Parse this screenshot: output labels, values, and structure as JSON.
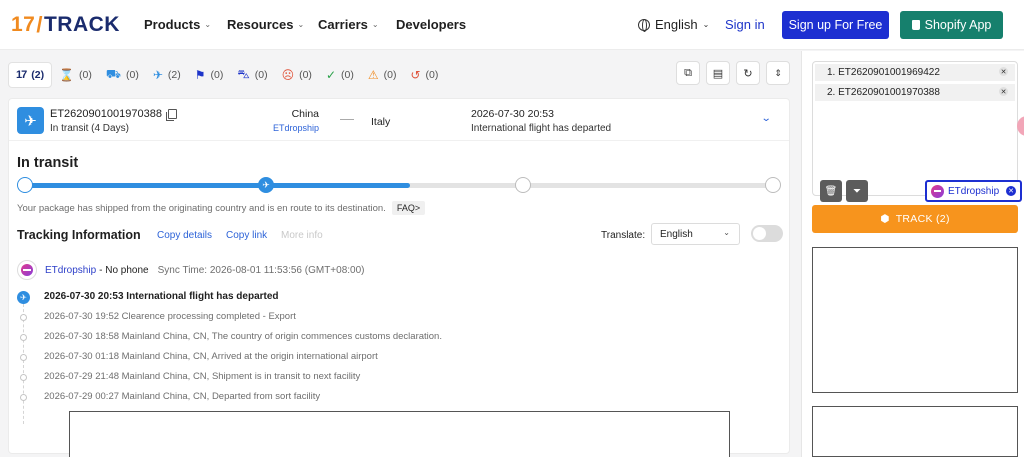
{
  "logo": {
    "num": "17",
    "word": "TRACK"
  },
  "nav": {
    "products": "Products",
    "resources": "Resources",
    "carriers": "Carriers",
    "developers": "Developers",
    "language": "English",
    "signin": "Sign in",
    "signup": "Sign up For Free",
    "shopify": "Shopify App"
  },
  "filters": [
    {
      "icon": "17",
      "count": "(2)"
    },
    {
      "icon": "⌛",
      "count": "(0)"
    },
    {
      "icon": "⛟",
      "count": "(0)"
    },
    {
      "icon": "✈",
      "count": "(2)"
    },
    {
      "icon": "⚑",
      "count": "(0)"
    },
    {
      "icon": "⛍",
      "count": "(0)"
    },
    {
      "icon": "☹",
      "count": "(0)"
    },
    {
      "icon": "✓",
      "count": "(0)"
    },
    {
      "icon": "⚠",
      "count": "(0)"
    },
    {
      "icon": "↺",
      "count": "(0)"
    }
  ],
  "shipment": {
    "number": "ET2620901001970388",
    "status": "In transit (4 Days)",
    "origin": "China",
    "carrier_small": "ETdropship",
    "destination": "Italy",
    "last_time": "2026-07-30 20:53",
    "last_event": "International flight has departed"
  },
  "section": {
    "title": "In transit",
    "progress_fraction": 0.5,
    "description": "Your package has shipped from the originating country and is en route to its destination.",
    "faq": "FAQ>"
  },
  "tracking_info": {
    "title": "Tracking Information",
    "copy_details": "Copy details",
    "copy_link": "Copy link",
    "more_info": "More info",
    "translate_label": "Translate:",
    "translate_value": "English"
  },
  "carrier": {
    "name": "ETdropship",
    "phone": "- No phone",
    "sync": "Sync Time: 2026-08-01 11:53:56 (GMT+08:00)"
  },
  "events": [
    "2026-07-30 20:53 International flight has departed",
    "2026-07-30 19:52 Clearence processing completed - Export",
    "2026-07-30 18:58 Mainland China, CN, The country of origin commences customs declaration.",
    "2026-07-30 01:18 Mainland China, CN, Arrived at the origin international airport",
    "2026-07-29 21:48 Mainland China, CN, Shipment is in transit to next facility",
    "2026-07-29 00:27 Mainland China, CN, Departed from sort facility"
  ],
  "input_numbers": [
    "1. ET2620901001969422",
    "2. ET2620901001970388"
  ],
  "selected_carrier": "ETdropship",
  "track_button": "TRACK  (2)",
  "colors": {
    "primary_blue": "#1d2fd1",
    "shopify_green": "#16806d",
    "track_orange": "#f7941d",
    "progress_blue": "#2f8ee0"
  }
}
